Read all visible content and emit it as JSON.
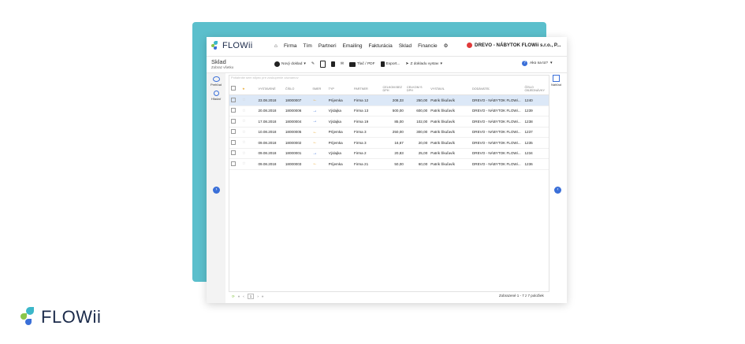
{
  "brand": {
    "name": "FLOWii"
  },
  "colors": {
    "accent": "#3a6fd8",
    "teal": "#5bbfcc",
    "selected_row": "#dce8f7",
    "incoming": "#e8a62a"
  },
  "nav": {
    "items": [
      "Firma",
      "Tím",
      "Partneri",
      "Emailing",
      "Fakturácia",
      "Sklad",
      "Financie"
    ],
    "company": "DREVO - NÁBYTOK FLOWii s.r.o., P..."
  },
  "module": {
    "title": "Sklad",
    "subtitle": "Zobraz všetko"
  },
  "toolbar": {
    "new_doc": "Nový doklad",
    "print": "Tlač / PDF",
    "export": "Export...",
    "send": "Z dokladu vystav",
    "help": "Ako na to?"
  },
  "sidebar": {
    "items": [
      {
        "label": "Prehľad",
        "icon": "eye-icon"
      },
      {
        "label": "Hľadať",
        "icon": "search-icon"
      }
    ]
  },
  "right_pane": {
    "label": "Náhľad"
  },
  "filter": {
    "placeholder": "Potiahnite sem stĺpec pre zoskupenie záznamov"
  },
  "table": {
    "headers": [
      "VYSTAVENÉ",
      "ČÍSLO",
      "SMER",
      "TYP",
      "PARTNER",
      "CELKOM BEZ DPH",
      "CELKOM S DPH",
      "VYSTAVIL",
      "DODÁVATEĽ",
      "ČÍSLO OBJEDNÁVKY"
    ],
    "rows": [
      {
        "date": "23.08.2018",
        "number": "18000007",
        "dir": "in",
        "type": "Príjemka",
        "partner": "Firma 12",
        "net": "208,33",
        "gross": "250,00",
        "issuer": "Patrik Škuľavík",
        "supplier": "DREVO - NÁBYTOK FLOWi...",
        "order": "1240",
        "selected": true
      },
      {
        "date": "20.08.2018",
        "number": "18000006",
        "dir": "out",
        "type": "Výdajka",
        "partner": "Firma 13",
        "net": "500,00",
        "gross": "600,00",
        "issuer": "Patrik Škuľavík",
        "supplier": "DREVO - NÁBYTOK FLOWi...",
        "order": "1239",
        "selected": false
      },
      {
        "date": "17.08.2018",
        "number": "18000004",
        "dir": "out",
        "type": "Výdajka",
        "partner": "Firma 19",
        "net": "85,00",
        "gross": "102,00",
        "issuer": "Patrik Škuľavík",
        "supplier": "DREVO - NÁBYTOK FLOWi...",
        "order": "1238",
        "selected": false
      },
      {
        "date": "10.08.2018",
        "number": "18000005",
        "dir": "in",
        "type": "Príjemka",
        "partner": "Firma 3",
        "net": "250,00",
        "gross": "300,00",
        "issuer": "Patrik Škuľavík",
        "supplier": "DREVO - NÁBYTOK FLOWi...",
        "order": "1237",
        "selected": false
      },
      {
        "date": "09.08.2018",
        "number": "18000002",
        "dir": "in",
        "type": "Príjemka",
        "partner": "Firma 3",
        "net": "16,67",
        "gross": "20,00",
        "issuer": "Patrik Škuľavík",
        "supplier": "DREVO - NÁBYTOK FLOWi...",
        "order": "1235",
        "selected": false
      },
      {
        "date": "09.08.2018",
        "number": "18000001",
        "dir": "out",
        "type": "Výdajka",
        "partner": "Firma 2",
        "net": "20,83",
        "gross": "25,00",
        "issuer": "Patrik Škuľavík",
        "supplier": "DREVO - NÁBYTOK FLOWi...",
        "order": "1234",
        "selected": false
      },
      {
        "date": "09.08.2018",
        "number": "18000003",
        "dir": "in",
        "type": "Príjemka",
        "partner": "Firma 21",
        "net": "50,00",
        "gross": "60,00",
        "issuer": "Patrik Škuľavík",
        "supplier": "DREVO - NÁBYTOK FLOWi...",
        "order": "1236",
        "selected": false
      }
    ]
  },
  "pager": {
    "current": "1",
    "summary": "Zobrazené 1 - 7 z 7 položiek"
  }
}
